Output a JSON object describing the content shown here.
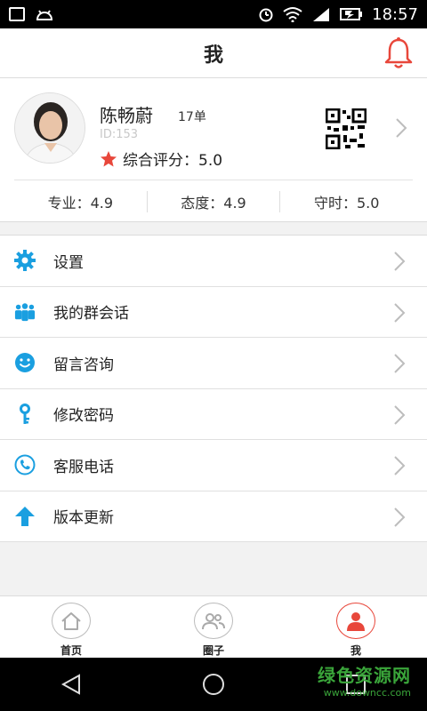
{
  "statusbar": {
    "time": "18:57"
  },
  "titlebar": {
    "title": "我"
  },
  "profile": {
    "name": "陈畅蔚",
    "orders": "17单",
    "id": "ID:153",
    "rating_label": "综合评分：5.0",
    "stats": [
      {
        "label": "专业：4.9"
      },
      {
        "label": "态度：4.9"
      },
      {
        "label": "守时：5.0"
      }
    ]
  },
  "menu": [
    {
      "label": "设置",
      "icon": "gear-icon"
    },
    {
      "label": "我的群会话",
      "icon": "group-icon"
    },
    {
      "label": "留言咨询",
      "icon": "smiley-icon"
    },
    {
      "label": "修改密码",
      "icon": "key-icon"
    },
    {
      "label": "客服电话",
      "icon": "phone-icon"
    },
    {
      "label": "版本更新",
      "icon": "arrow-up-icon"
    }
  ],
  "tabs": [
    {
      "label": "首页",
      "icon": "home-icon"
    },
    {
      "label": "圈子",
      "icon": "people-icon"
    },
    {
      "label": "我",
      "icon": "person-icon"
    }
  ],
  "watermark": {
    "main": "绿色资源网",
    "url": "www.downcc.com"
  },
  "colors": {
    "accent": "#e8473b",
    "icon_blue": "#1a9fe0"
  }
}
